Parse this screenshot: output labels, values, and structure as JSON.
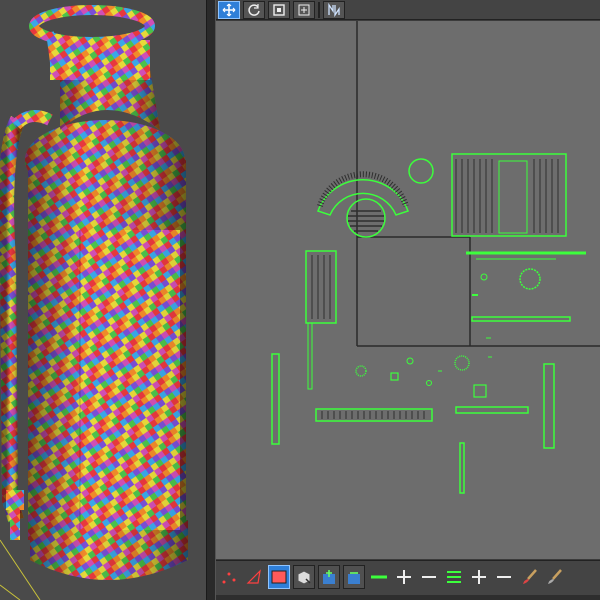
{
  "window": {
    "title": ""
  },
  "left_viewport": {
    "object": "fire-extinguisher-model",
    "texture": "checker-rainbow"
  },
  "uv_toolbar_top": {
    "tools": [
      {
        "name": "move-tool",
        "icon": "move-icon",
        "active": true
      },
      {
        "name": "rotate-tool",
        "icon": "rotate-icon",
        "active": false
      },
      {
        "name": "scale-tool",
        "icon": "scale-icon",
        "active": false
      },
      {
        "name": "freeform-tool",
        "icon": "freeform-icon",
        "active": false
      },
      {
        "name": "mirror-tool",
        "icon": "mirror-icon",
        "active": false
      }
    ]
  },
  "uv_toolbar_bottom": {
    "tools": [
      {
        "name": "vertex-mode",
        "icon": "vertex-icon"
      },
      {
        "name": "edge-mode",
        "icon": "edge-icon"
      },
      {
        "name": "face-mode",
        "icon": "face-icon",
        "active": true
      },
      {
        "name": "element-mode",
        "icon": "element-icon"
      },
      {
        "name": "grow-selection",
        "icon": "grow-icon"
      },
      {
        "name": "shrink-selection",
        "icon": "shrink-icon"
      },
      {
        "name": "loop-select",
        "icon": "loop-icon"
      },
      {
        "name": "grow-loop",
        "icon": "plus-icon"
      },
      {
        "name": "shrink-loop",
        "icon": "minus-icon"
      },
      {
        "name": "ring-select",
        "icon": "ring-icon"
      },
      {
        "name": "grow-ring",
        "icon": "plus-icon"
      },
      {
        "name": "shrink-ring",
        "icon": "minus-icon"
      },
      {
        "name": "paint-select",
        "icon": "brush-icon"
      },
      {
        "name": "brush-size",
        "icon": "brush-size-icon"
      }
    ]
  },
  "colors": {
    "uv_edge": "#3cff3c",
    "uv_canvas_bg": "#6d6d6d",
    "tile_border": "#2b2b2b",
    "active_button": "#2f7fd8"
  }
}
